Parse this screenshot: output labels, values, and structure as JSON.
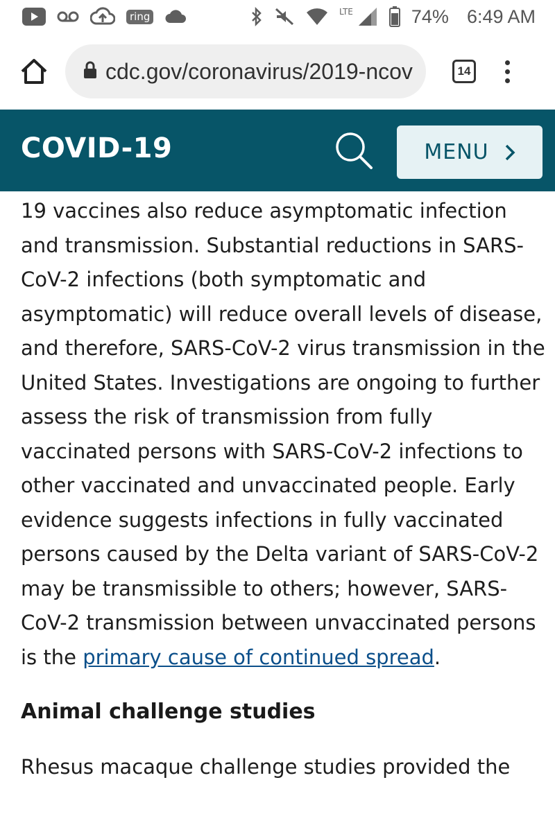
{
  "status_bar": {
    "icons_left": [
      "youtube-icon",
      "voicemail-icon",
      "cloud-upload-icon",
      "ring-icon",
      "cloud-icon"
    ],
    "ring_label": "ring",
    "icons_right": [
      "bluetooth-icon",
      "mute-icon",
      "wifi-icon",
      "signal-icon",
      "battery-icon"
    ],
    "network": "LTE",
    "battery": "74%",
    "time": "6:49 AM"
  },
  "browser": {
    "url": "cdc.gov/coronavirus/2019-ncov",
    "tab_count": "14"
  },
  "header": {
    "title": "COVID-19",
    "menu_label": "MENU",
    "color": "#075568"
  },
  "content": {
    "paragraph_start": "19 vaccines also reduce asymptomatic infection and transmission. Substantial reductions in SARS-CoV-2 infections (both symptomatic and asymptomatic) will reduce overall levels of disease, and therefore, SARS-CoV-2 virus transmission in the United States. Investigations are ongoing to further assess the risk of transmission from fully vaccinated persons with SARS-CoV-2 infections to other vaccinated and unvaccinated people. Early evidence suggests infections in fully vaccinated persons caused by the Delta variant of SARS-CoV-2 may be transmissible to others; however, SARS-CoV-2 transmission between unvaccinated persons is the ",
    "link_text": "primary cause of continued spread",
    "paragraph_end": ".",
    "heading": "Animal challenge studies",
    "next_paragraph": "Rhesus macaque challenge studies provided the"
  }
}
